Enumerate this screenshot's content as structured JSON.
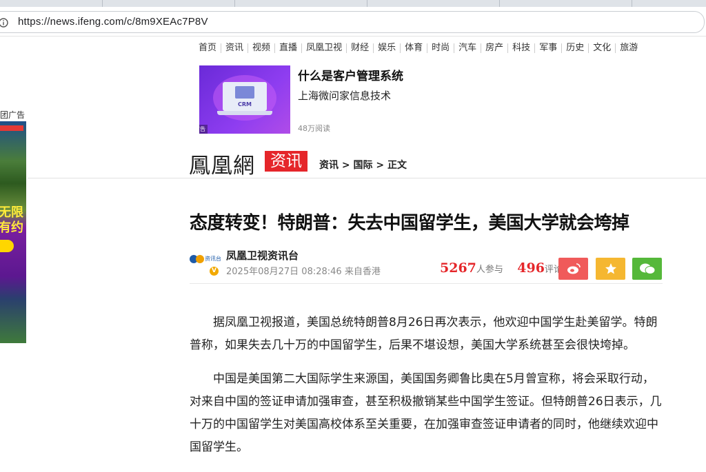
{
  "browser": {
    "url": "https://news.ifeng.com/c/8m9XEAc7P8V"
  },
  "left_ad": {
    "label": "团广告",
    "text_line1": "无限",
    "text_line2": "有约"
  },
  "nav": {
    "items": [
      "首页",
      "资讯",
      "视频",
      "直播",
      "凤凰卫视",
      "财经",
      "娱乐",
      "体育",
      "时尚",
      "汽车",
      "房产",
      "科技",
      "军事",
      "历史",
      "文化",
      "旅游"
    ]
  },
  "sponsored": {
    "title": "什么是客户管理系统",
    "subtitle": "上海微问家信息技术",
    "reads": "48万阅读",
    "thumb_text": "CRM",
    "ad_tag": "广告"
  },
  "header": {
    "logo": "鳳凰網",
    "logo_tag": "资讯",
    "breadcrumb": "资讯 > 国际 > 正文"
  },
  "article": {
    "title": "态度转变！特朗普：失去中国留学生，美国大学就会垮掉",
    "source_name": "凤凰卫视资讯台",
    "source_logo_text": "资讯台",
    "time": "2025年08月27日 08:28:46 来自香港",
    "participants": "5267",
    "participants_label": "人参与",
    "comments": "496",
    "comments_label": "评论",
    "paragraphs": [
      "据凤凰卫视报道，美国总统特朗普8月26日再次表示，他欢迎中国学生赴美留学。特朗普称，如果失去几十万的中国留学生，后果不堪设想，美国大学系统甚至会很快垮掉。",
      "中国是美国第二大国际学生来源国，美国国务卿鲁比奥在5月曾宣称，将会采取行动，对来自中国的签证申请加强审查，甚至积极撤销某些中国学生签证。但特朗普26日表示，几十万的中国留学生对美国高校体系至关重要，在加强审查签证申请者的同时，他继续欢迎中国留学生。"
    ]
  },
  "share": {
    "weibo_icon": "weibo-icon",
    "favorite_icon": "star-icon",
    "wechat_icon": "wechat-icon"
  },
  "colors": {
    "brand_red": "#e5262a",
    "weibo": "#f05a5a",
    "favorite": "#f5b731",
    "wechat": "#55b83a"
  }
}
